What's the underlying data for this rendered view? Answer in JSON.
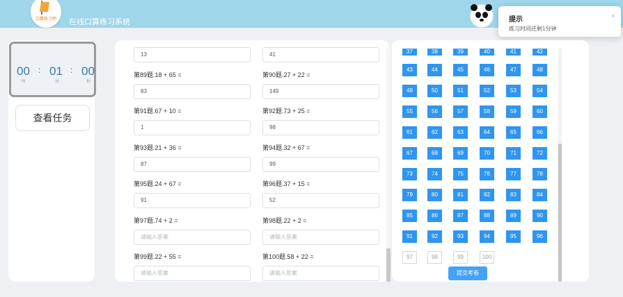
{
  "app": {
    "title": "在线口算练习系统",
    "logo_text": "口算练习吧"
  },
  "notification": {
    "title": "提示",
    "message": "练习时间还剩1分钟",
    "close_icon": "×"
  },
  "timer": {
    "hours": "00",
    "minutes": "01",
    "seconds": "00",
    "separator": ":",
    "unit_hours": "时",
    "unit_minutes": "分",
    "unit_seconds": "秒"
  },
  "task_button": "查看任务",
  "questions": [
    {
      "label": "",
      "answer": "13",
      "placeholder": "请输入答案"
    },
    {
      "label": "",
      "answer": "41",
      "placeholder": "请输入答案"
    },
    {
      "label": "第89题.18 + 65 =",
      "answer": "83",
      "placeholder": "请输入答案"
    },
    {
      "label": "第90题.27 + 22 =",
      "answer": "149",
      "placeholder": "请输入答案"
    },
    {
      "label": "第91题.67 + 10 =",
      "answer": "1",
      "placeholder": "请输入答案"
    },
    {
      "label": "第92题.73 + 25 =",
      "answer": "98",
      "placeholder": "请输入答案"
    },
    {
      "label": "第93题.21 + 36 =",
      "answer": "87",
      "placeholder": "请输入答案"
    },
    {
      "label": "第94题.32 + 67 =",
      "answer": "99",
      "placeholder": "请输入答案"
    },
    {
      "label": "第95题.24 + 67 =",
      "answer": "91",
      "placeholder": "请输入答案"
    },
    {
      "label": "第96题.37 + 15 =",
      "answer": "52",
      "placeholder": "请输入答案"
    },
    {
      "label": "第97题.74 + 2 =",
      "answer": "",
      "placeholder": "请输入答案"
    },
    {
      "label": "第98题.22 + 2 =",
      "answer": "",
      "placeholder": "请输入答案"
    },
    {
      "label": "第99题.22 + 55 =",
      "answer": "",
      "placeholder": "请输入答案"
    },
    {
      "label": "第100题.58 + 22 =",
      "answer": "",
      "placeholder": "请输入答案"
    }
  ],
  "answer_sheet": {
    "numbers": [
      "37",
      "38",
      "39",
      "40",
      "41",
      "42",
      "43",
      "44",
      "45",
      "46",
      "47",
      "48",
      "49",
      "50",
      "51",
      "52",
      "53",
      "54",
      "55",
      "56",
      "57",
      "58",
      "59",
      "60",
      "61",
      "62",
      "63",
      "64",
      "65",
      "66",
      "67",
      "68",
      "69",
      "70",
      "71",
      "72",
      "73",
      "74",
      "75",
      "76",
      "77",
      "78",
      "79",
      "80",
      "81",
      "82",
      "83",
      "84",
      "85",
      "86",
      "87",
      "88",
      "89",
      "90",
      "91",
      "92",
      "93",
      "94",
      "95",
      "96",
      "97",
      "98",
      "99",
      "100"
    ],
    "answered_through": 96
  },
  "submit_button": "提交考卷",
  "colors": {
    "header": "#9fd6ea",
    "answered": "#2f95ef",
    "submit": "#46a2f5"
  }
}
